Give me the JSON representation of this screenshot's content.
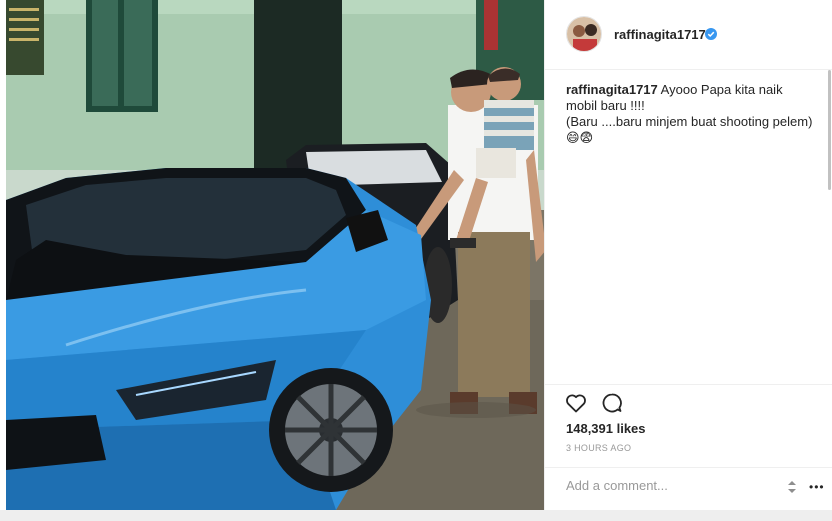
{
  "post": {
    "username": "raffinagita1717",
    "verified": true
  },
  "caption": {
    "username": "raffinagita1717",
    "line1": "Ayooo Papa kita naik",
    "line2": "mobil baru !!!!",
    "line3": "(Baru ....baru minjem buat shooting pelem)",
    "emoji": "😄😨"
  },
  "stats": {
    "likes": "148,391 likes",
    "time": "3 HOURS AGO"
  },
  "comment": {
    "placeholder": "Add a comment..."
  },
  "colors": {
    "car": "#2f8ed6",
    "wall": "#9fc3a6",
    "verified": "#3897f0"
  },
  "icons": {
    "like": "heart-icon",
    "comment": "comment-icon",
    "more": "more-options-icon"
  }
}
